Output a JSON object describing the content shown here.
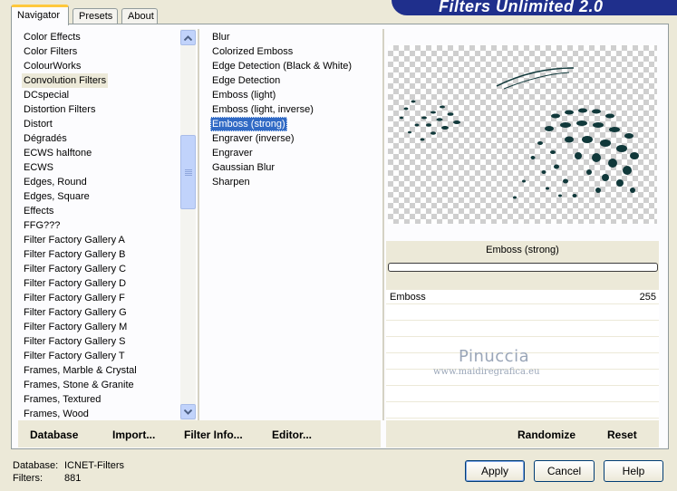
{
  "window": {
    "title": "Filters Unlimited 2.0"
  },
  "tabs": [
    {
      "label": "Navigator",
      "active": true
    },
    {
      "label": "Presets",
      "active": false
    },
    {
      "label": "About",
      "active": false
    }
  ],
  "categories": {
    "selected_index": 3,
    "items": [
      "Color Effects",
      "Color Filters",
      "ColourWorks",
      "Convolution Filters",
      "DCspecial",
      "Distortion Filters",
      "Distort",
      "Dégradés",
      "ECWS halftone",
      "ECWS",
      "Edges, Round",
      "Edges, Square",
      "Effects",
      "FFG???",
      "Filter Factory Gallery A",
      "Filter Factory Gallery B",
      "Filter Factory Gallery C",
      "Filter Factory Gallery D",
      "Filter Factory Gallery F",
      "Filter Factory Gallery G",
      "Filter Factory Gallery M",
      "Filter Factory Gallery S",
      "Filter Factory Gallery T",
      "Frames, Marble & Crystal",
      "Frames, Stone & Granite",
      "Frames, Textured",
      "Frames, Wood"
    ]
  },
  "filters": {
    "selected_index": 6,
    "items": [
      "Blur",
      "Colorized Emboss",
      "Edge Detection (Black & White)",
      "Edge Detection",
      "Emboss (light)",
      "Emboss (light, inverse)",
      "Emboss (strong)",
      "Engraver (inverse)",
      "Engraver",
      "Gaussian Blur",
      "Sharpen"
    ]
  },
  "preview": {
    "filter_name": "Emboss (strong)",
    "params": [
      {
        "name": "Emboss",
        "value": "255"
      }
    ]
  },
  "watermark": {
    "name": "Pinuccia",
    "url": "www.maidiregrafica.eu"
  },
  "toolbar": {
    "database": "Database",
    "import": "Import...",
    "filter_info": "Filter Info...",
    "editor": "Editor...",
    "randomize": "Randomize",
    "reset": "Reset"
  },
  "footer": {
    "database_label": "Database:",
    "database_value": "ICNET-Filters",
    "filters_label": "Filters:",
    "filters_value": "881",
    "apply": "Apply",
    "cancel": "Cancel",
    "help": "Help"
  },
  "colors": {
    "banner": "#1f2f8c",
    "selection": "#316ac5",
    "face": "#ece9d8"
  }
}
